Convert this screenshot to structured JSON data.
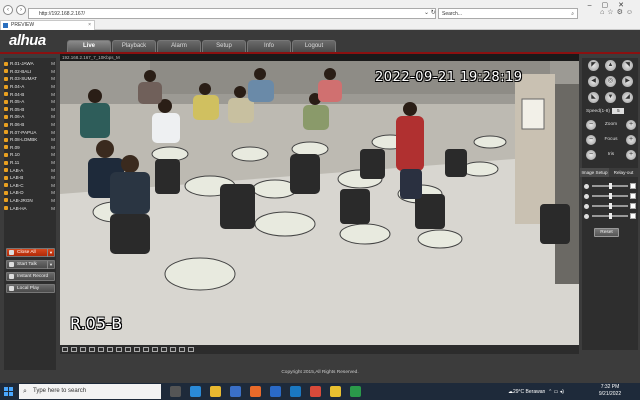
{
  "browser": {
    "url": "http://192.168.2.167/",
    "search_placeholder": "Search...",
    "tab_title": "PREVIEW"
  },
  "app": {
    "logo": "alhua",
    "nav": [
      "Live",
      "Playback",
      "Alarm",
      "Setup",
      "Info",
      "Logout"
    ],
    "active_nav": "Live"
  },
  "channels": [
    {
      "name": "R.01-JAWA",
      "flag": "M"
    },
    {
      "name": "R.02-BALI",
      "flag": "M"
    },
    {
      "name": "R.03-SUMAT",
      "flag": "M"
    },
    {
      "name": "R.04-A",
      "flag": "M"
    },
    {
      "name": "R.04-B",
      "flag": "M"
    },
    {
      "name": "R.05-A",
      "flag": "M"
    },
    {
      "name": "R.05-B",
      "flag": "M"
    },
    {
      "name": "R.06-A",
      "flag": "M"
    },
    {
      "name": "R.06-B",
      "flag": "M"
    },
    {
      "name": "R.07-PAPUA",
      "flag": "M"
    },
    {
      "name": "R.08-LOMBK",
      "flag": "M"
    },
    {
      "name": "R.09",
      "flag": "M"
    },
    {
      "name": "R.10",
      "flag": "M"
    },
    {
      "name": "R.11",
      "flag": "M"
    },
    {
      "name": "LAB-A",
      "flag": "M"
    },
    {
      "name": "LAB-B",
      "flag": "M"
    },
    {
      "name": "LAB-C",
      "flag": "M"
    },
    {
      "name": "LAB-D",
      "flag": "M"
    },
    {
      "name": "LAB-JRGN",
      "flag": "M"
    },
    {
      "name": "LAB-HA",
      "flag": "M"
    }
  ],
  "left_buttons": {
    "close_all": "Close All",
    "start_talk": "Start Talk",
    "instant_record": "Instant Record",
    "local_play": "Local Play"
  },
  "video": {
    "info_bar": "192.168.2.167_7_10Kbps_M",
    "timestamp": "2022-09-21  19:28:19",
    "camera_name": "R.05-B"
  },
  "ptz": {
    "speed_label": "Speed(1-8)",
    "speed_value": "5",
    "zoom": "Zoom",
    "focus": "Focus",
    "iris": "Iris"
  },
  "image_setup": {
    "tab1": "Image Setup",
    "tab2": "Relay-out",
    "reset": "Reset",
    "slider_levels": [
      0.5,
      0.5,
      0.5,
      0.5
    ]
  },
  "footer": {
    "copyright": "Copyright 2015,All Rights Reserved."
  },
  "taskbar": {
    "search_placeholder": "Type here to search",
    "weather": "29°C  Berawan",
    "time": "7:32 PM",
    "date": "9/21/2022"
  }
}
